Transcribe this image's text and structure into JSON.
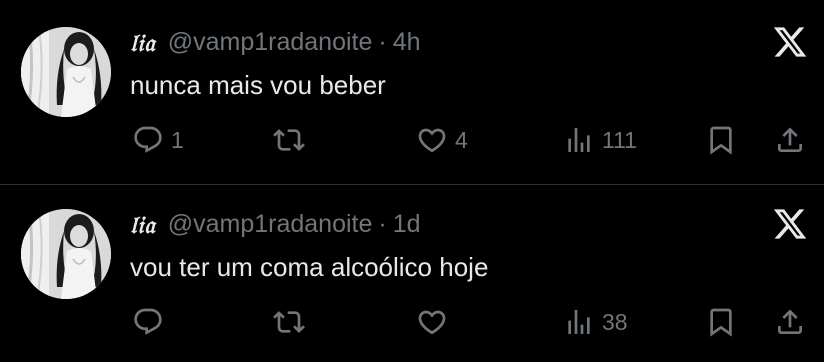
{
  "colors": {
    "background": "#000000",
    "primary_text": "#e7e9ea",
    "secondary_text": "#71767b",
    "divider": "#2f3336"
  },
  "tweets": [
    {
      "display_name": "𝔩𝔦𝔞",
      "handle": "@vamp1radanoite",
      "separator": "·",
      "time": "4h",
      "text": "nunca mais vou beber",
      "replies": "1",
      "retweets": "",
      "likes": "4",
      "views": "111"
    },
    {
      "display_name": "𝔩𝔦𝔞",
      "handle": "@vamp1radanoite",
      "separator": "·",
      "time": "1d",
      "text": "vou ter um coma alcoólico hoje",
      "replies": "",
      "retweets": "",
      "likes": "",
      "views": "38"
    }
  ],
  "icons": {
    "logo": "x-logo-icon",
    "reply": "reply-icon",
    "retweet": "retweet-icon",
    "like": "heart-icon",
    "views": "views-icon",
    "bookmark": "bookmark-icon",
    "share": "share-icon"
  }
}
